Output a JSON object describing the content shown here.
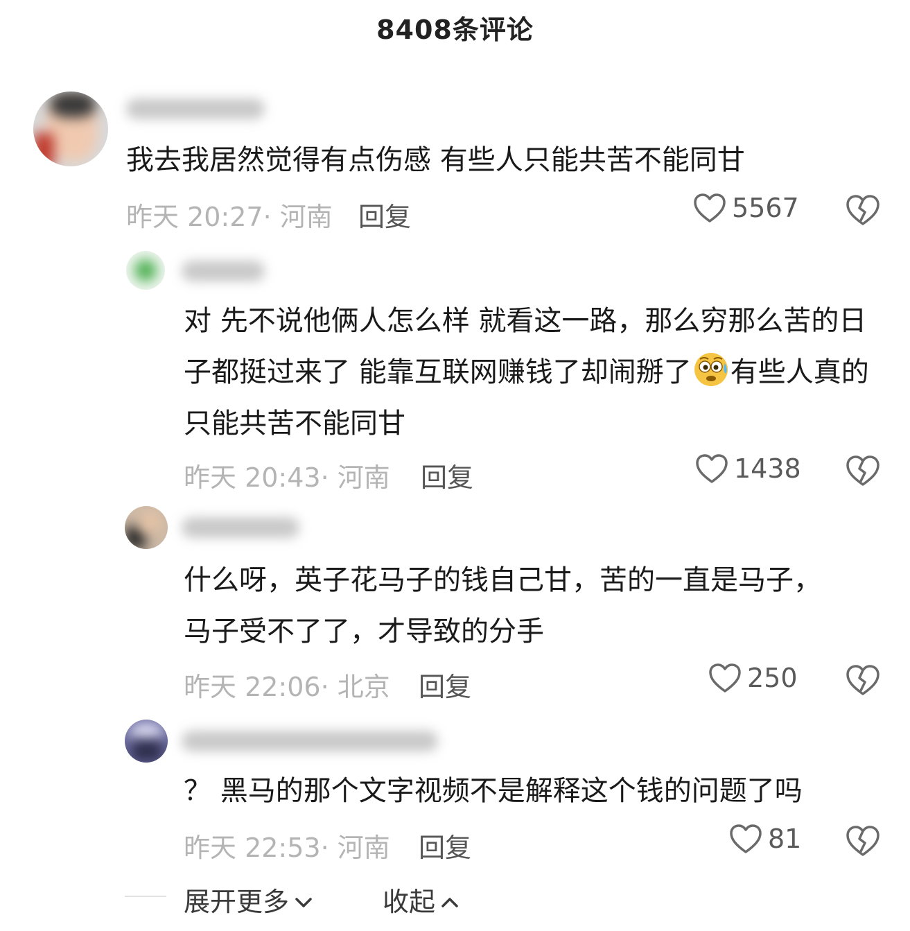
{
  "header": {
    "title": "8408条评论"
  },
  "comments": [
    {
      "text": "我去我居然觉得有点伤感 有些人只能共苦不能同甘",
      "time": "昨天 20:27",
      "location": "河南",
      "reply_label": "回复",
      "likes": "5567"
    },
    {
      "text": "对 先不说他俩人怎么样 就看这一路，那么穷那么苦的日子都挺过来了 能靠互联网赚钱了却闹掰了",
      "text_after_emoji": "有些人真的只能共苦不能同甘",
      "emoji": "sweat-face-emoji",
      "time": "昨天 20:43",
      "location": "河南",
      "reply_label": "回复",
      "likes": "1438"
    },
    {
      "text": "什么呀，英子花马子的钱自己甘，苦的一直是马子，马子受不了了，才导致的分手",
      "time": "昨天 22:06",
      "location": "北京",
      "reply_label": "回复",
      "likes": "250"
    },
    {
      "text": "？ 黑马的那个文字视频不是解释这个钱的问题了吗",
      "time": "昨天 22:53",
      "location": "河南",
      "reply_label": "回复",
      "likes": "81"
    }
  ],
  "footer": {
    "expand_label": "展开更多",
    "collapse_label": "收起"
  },
  "icons": {
    "like": "heart-outline-icon",
    "dislike": "broken-heart-icon",
    "expand": "chevron-down-icon",
    "collapse": "chevron-up-icon"
  },
  "colors": {
    "meta": "#b4b4b4",
    "text": "#1a1a1a",
    "icon": "#6a6a6a"
  }
}
